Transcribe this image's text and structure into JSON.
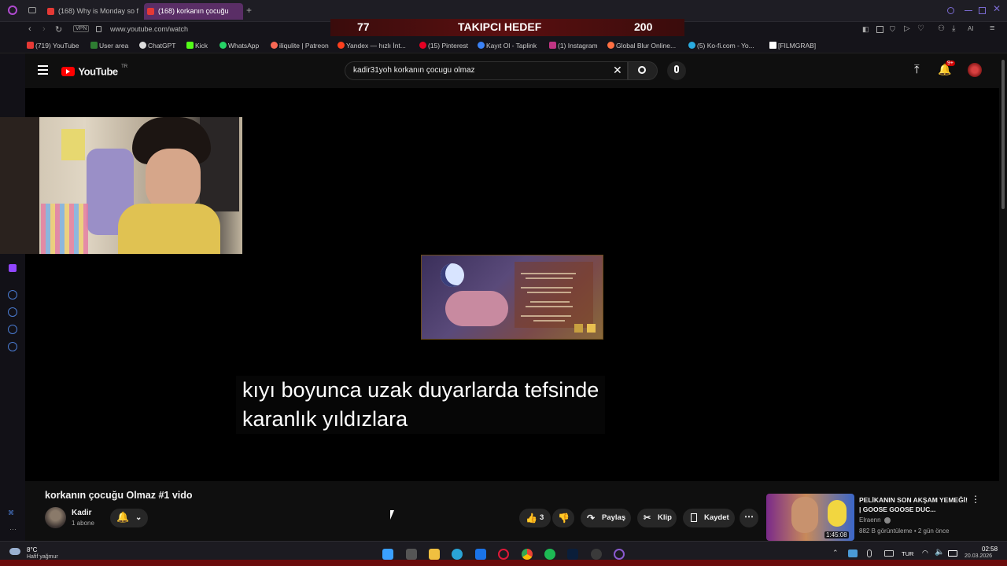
{
  "browser": {
    "tabs": [
      {
        "label": "(168) Why is Monday so fa",
        "active": false
      },
      {
        "label": "(168) korkanın çocuğu",
        "active": true
      }
    ],
    "new_tab": "+",
    "address": "www.youtube.com/watch",
    "vpn": "VPN"
  },
  "overlay": {
    "left_number": "77",
    "title": "TAKIPCI HEDEF",
    "right_number": "200"
  },
  "bookmarks": [
    {
      "label": "(719) YouTube",
      "color": "#e53935"
    },
    {
      "label": "User area",
      "color": "#2e7d32"
    },
    {
      "label": "ChatGPT",
      "color": "#dddddd"
    },
    {
      "label": "Kick",
      "color": "#53fc18"
    },
    {
      "label": "WhatsApp",
      "color": "#25d366"
    },
    {
      "label": "iliqulite | Patreon",
      "color": "#f96854"
    },
    {
      "label": "Yandex — hızlı İnt...",
      "color": "#fc3f1d"
    },
    {
      "label": "(15) Pinterest",
      "color": "#e60023"
    },
    {
      "label": "Kayıt Ol - Taplink",
      "color": "#3b82f6"
    },
    {
      "label": "(1) Instagram",
      "color": "#c13584"
    },
    {
      "label": "Global Blur Online...",
      "color": "#ff7043"
    },
    {
      "label": "(5) Ko-fi.com - Yo...",
      "color": "#29abe0"
    },
    {
      "label": "[FILMGRAB]",
      "color": "#ffffff"
    }
  ],
  "youtube": {
    "logo": "YouTube",
    "country": "TR",
    "search_value": "kadir31yoh korkanın çocugu olmaz",
    "notifications_badge": "9+"
  },
  "video": {
    "caption_lines": [
      "kıyı boyunca uzak duyarlarda tefsinde",
      "karanlık yıldızlara"
    ]
  },
  "video_info": {
    "title": "korkanın çocuğu Olmaz #1 vido",
    "channel": "Kadir",
    "subscribers": "1 abone",
    "like_count": "3",
    "share_label": "Paylaş",
    "clip_label": "Klip",
    "save_label": "Kaydet"
  },
  "recommended": {
    "title": "PELİKANIN SON AKŞAM YEMEĞİ! | GOOSE GOOSE DUC...",
    "channel": "Elraenn",
    "meta": "882 B görüntüleme • 2 gün önce",
    "duration": "1:45:08"
  },
  "taskbar": {
    "weather_temp": "8°C",
    "weather_desc": "Hafif yağmur",
    "lang": "TUR",
    "time": "02:58",
    "date": "20.03.2026"
  }
}
